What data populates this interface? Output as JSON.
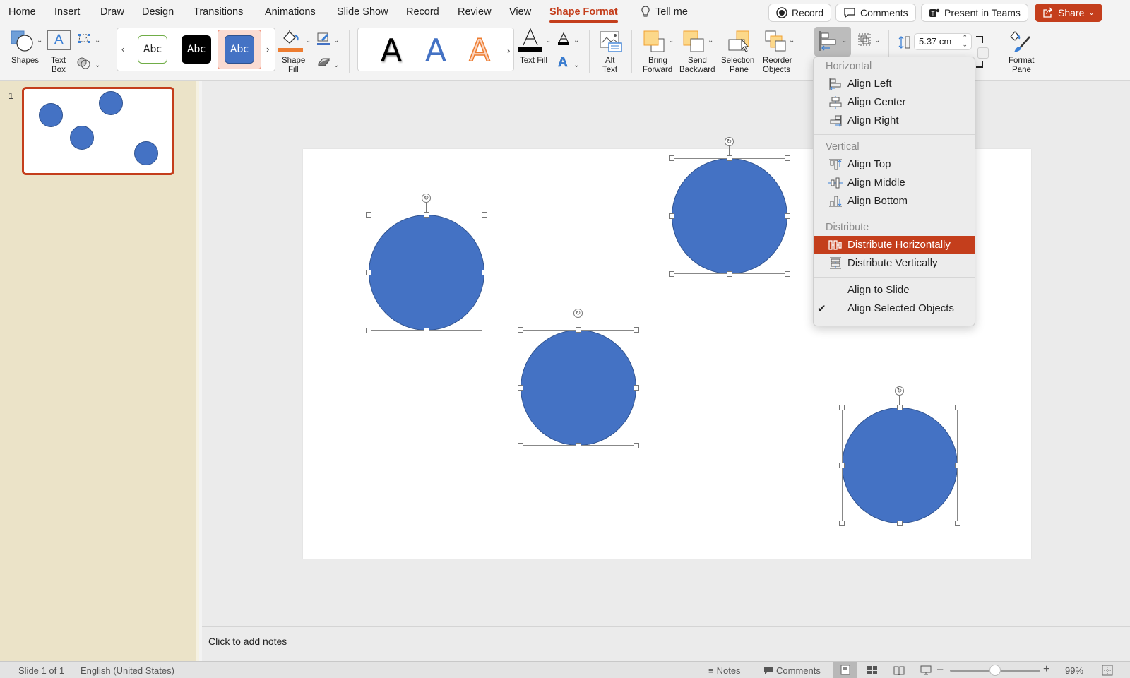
{
  "menu_tabs": [
    {
      "label": "Home",
      "active": false
    },
    {
      "label": "Insert",
      "active": false
    },
    {
      "label": "Draw",
      "active": false
    },
    {
      "label": "Design",
      "active": false
    },
    {
      "label": "Transitions",
      "active": false
    },
    {
      "label": "Animations",
      "active": false
    },
    {
      "label": "Slide Show",
      "active": false
    },
    {
      "label": "Record",
      "active": false
    },
    {
      "label": "Review",
      "active": false
    },
    {
      "label": "View",
      "active": false
    },
    {
      "label": "Shape Format",
      "active": true
    }
  ],
  "tell_me": "Tell me",
  "top_buttons": {
    "record": "Record",
    "comments": "Comments",
    "present_in_teams": "Present in Teams",
    "share": "Share"
  },
  "ribbon": {
    "shapes": "Shapes",
    "text_box_1": "Text",
    "text_box_2": "Box",
    "shape_style_samples": [
      "Abc",
      "Abc",
      "Abc"
    ],
    "shape_fill_1": "Shape",
    "shape_fill_2": "Fill",
    "wordart_samples": [
      "A",
      "A",
      "A"
    ],
    "text_fill": "Text Fill",
    "alt_text_1": "Alt",
    "alt_text_2": "Text",
    "bring_forward_1": "Bring",
    "bring_forward_2": "Forward",
    "send_backward_1": "Send",
    "send_backward_2": "Backward",
    "selection_pane_1": "Selection",
    "selection_pane_2": "Pane",
    "reorder_objects_1": "Reorder",
    "reorder_objects_2": "Objects",
    "height_value": "5.37 cm",
    "format_pane_1": "Format",
    "format_pane_2": "Pane"
  },
  "colors": {
    "accent": "#c43e1c",
    "shape_fill": "#4472c4",
    "shape_fill_swatch": "#ed7d31",
    "line_color_swatch": "#4472c4",
    "left_pane_bg": "#ebe3c8"
  },
  "slide_panel": {
    "slide_number": "1"
  },
  "align_menu": {
    "sections": {
      "horizontal": "Horizontal",
      "vertical": "Vertical",
      "distribute": "Distribute"
    },
    "items": [
      {
        "label": "Align Left",
        "icon": "align-left-icon"
      },
      {
        "label": "Align Center",
        "icon": "align-center-icon"
      },
      {
        "label": "Align Right",
        "icon": "align-right-icon"
      },
      {
        "label": "Align Top",
        "icon": "align-top-icon"
      },
      {
        "label": "Align Middle",
        "icon": "align-middle-icon"
      },
      {
        "label": "Align Bottom",
        "icon": "align-bottom-icon"
      },
      {
        "label": "Distribute Horizontally",
        "icon": "distribute-horizontally-icon",
        "highlighted": true
      },
      {
        "label": "Distribute Vertically",
        "icon": "distribute-vertically-icon"
      },
      {
        "label": "Align to Slide",
        "checked": false
      },
      {
        "label": "Align Selected Objects",
        "checked": true
      }
    ]
  },
  "notes_placeholder": "Click to add notes",
  "status_bar": {
    "slide_info": "Slide 1 of 1",
    "language": "English (United States)",
    "notes": "Notes",
    "comments": "Comments",
    "zoom_percent": "99%",
    "zoom_slider_fraction": 0.5
  }
}
